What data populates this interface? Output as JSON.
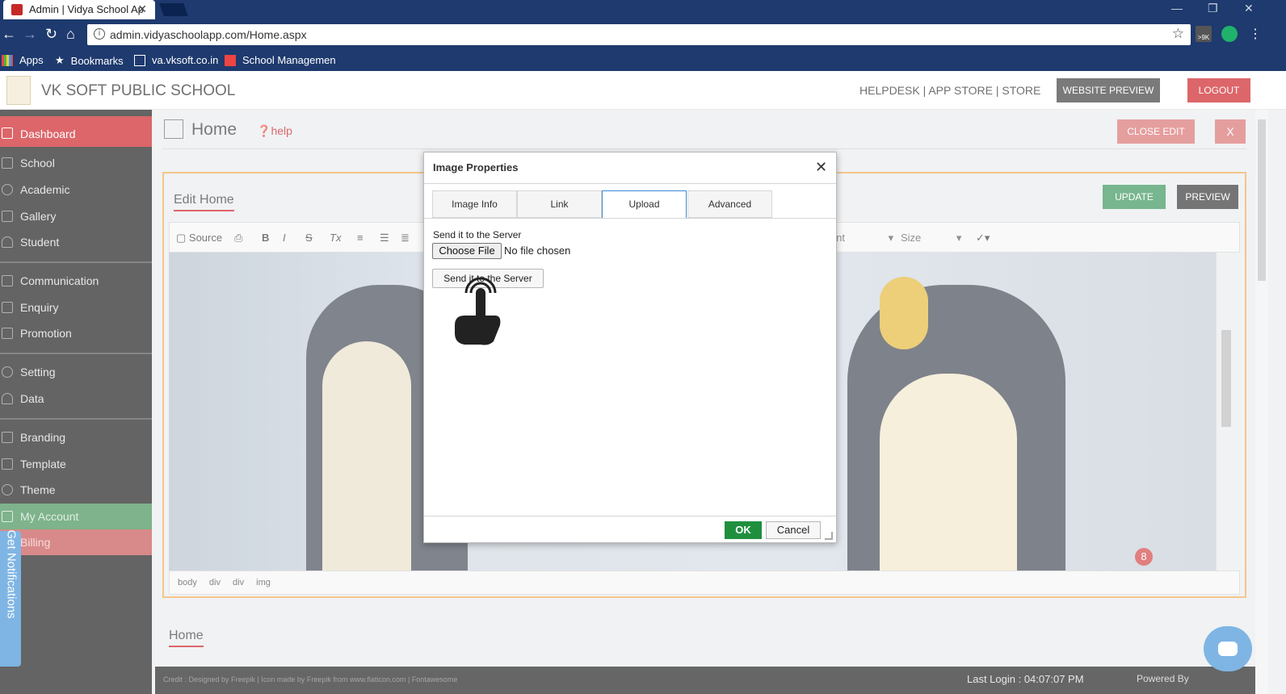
{
  "browser": {
    "tab_title": "Admin | Vidya School Ap",
    "url": "admin.vidyaschoolapp.com/Home.aspx",
    "bookmarks": [
      "Apps",
      "Bookmarks",
      "va.vksoft.co.in",
      "School Managemen"
    ],
    "ext_badge": ">9K"
  },
  "header": {
    "school_name": "VK SOFT PUBLIC SCHOOL",
    "links": "HELPDESK  |  APP STORE  |  STORE",
    "website_preview": "WEBSITE PREVIEW",
    "logout": "LOGOUT"
  },
  "sidebar": {
    "items": [
      "Dashboard",
      "School",
      "Academic",
      "Gallery",
      "Student",
      "Communication",
      "Enquiry",
      "Promotion",
      "Setting",
      "Data",
      "Branding",
      "Template",
      "Theme",
      "My Account",
      "Billing"
    ],
    "notifications": "Get Notifications"
  },
  "page": {
    "title": "Home",
    "help": "help",
    "close_edit": "CLOSE EDIT",
    "x": "X",
    "edit_title": "Edit Home",
    "update": "UPDATE",
    "preview": "PREVIEW",
    "toolbar": {
      "source": "Source",
      "font": "Font",
      "size": "Size",
      "bold": "B",
      "italic": "I",
      "strike": "S",
      "clear": "Tx"
    },
    "status_path": "body  div  div  img",
    "badge": "8",
    "home_tab": "Home",
    "footer_credit": "Credit : Designed by Freepik | Icon made by Freepik from www.flaticon.com | Fontawesome",
    "last_login": "Last Login : 04:07:07 PM",
    "powered_by": "Powered By"
  },
  "dialog": {
    "title": "Image Properties",
    "tabs": [
      "Image Info",
      "Link",
      "Upload",
      "Advanced"
    ],
    "active_tab": "Upload",
    "send_label": "Send it to the Server",
    "choose_file": "Choose File",
    "no_file": "No file chosen",
    "send_button": "Send it to the Server",
    "ok": "OK",
    "cancel": "Cancel"
  },
  "colors": {
    "chrome": "#1e3a6e",
    "brand_red": "#c9151b",
    "active_green": "#2f8f52",
    "tab_blue": "#3a8bd8"
  }
}
